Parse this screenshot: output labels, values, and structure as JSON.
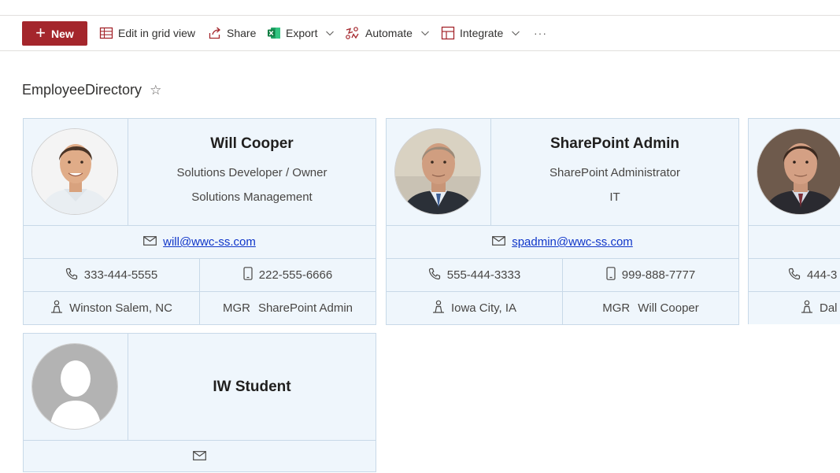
{
  "commandbar": {
    "new_label": "New",
    "edit_grid_label": "Edit in grid view",
    "share_label": "Share",
    "export_label": "Export",
    "automate_label": "Automate",
    "integrate_label": "Integrate",
    "more_label": "···"
  },
  "list": {
    "title": "EmployeeDirectory"
  },
  "employees": [
    {
      "name": "Will Cooper",
      "title": "Solutions Developer / Owner",
      "department": "Solutions Management",
      "email": "will@wwc-ss.com",
      "phone": "333-444-5555",
      "mobile": "222-555-6666",
      "location": "Winston Salem, NC",
      "manager_label": "MGR",
      "manager": "SharePoint Admin"
    },
    {
      "name": "SharePoint Admin",
      "title": "SharePoint Administrator",
      "department": "IT",
      "email": "spadmin@wwc-ss.com",
      "phone": "555-444-3333",
      "mobile": "999-888-7777",
      "location": "Iowa City, IA",
      "manager_label": "MGR",
      "manager": "Will Cooper"
    },
    {
      "phone": "444-3",
      "location": "Dal"
    },
    {
      "name": "IW Student"
    }
  ],
  "colors": {
    "brand": "#a4262c",
    "card_bg": "#eff6fc",
    "link": "#0f35c9"
  }
}
